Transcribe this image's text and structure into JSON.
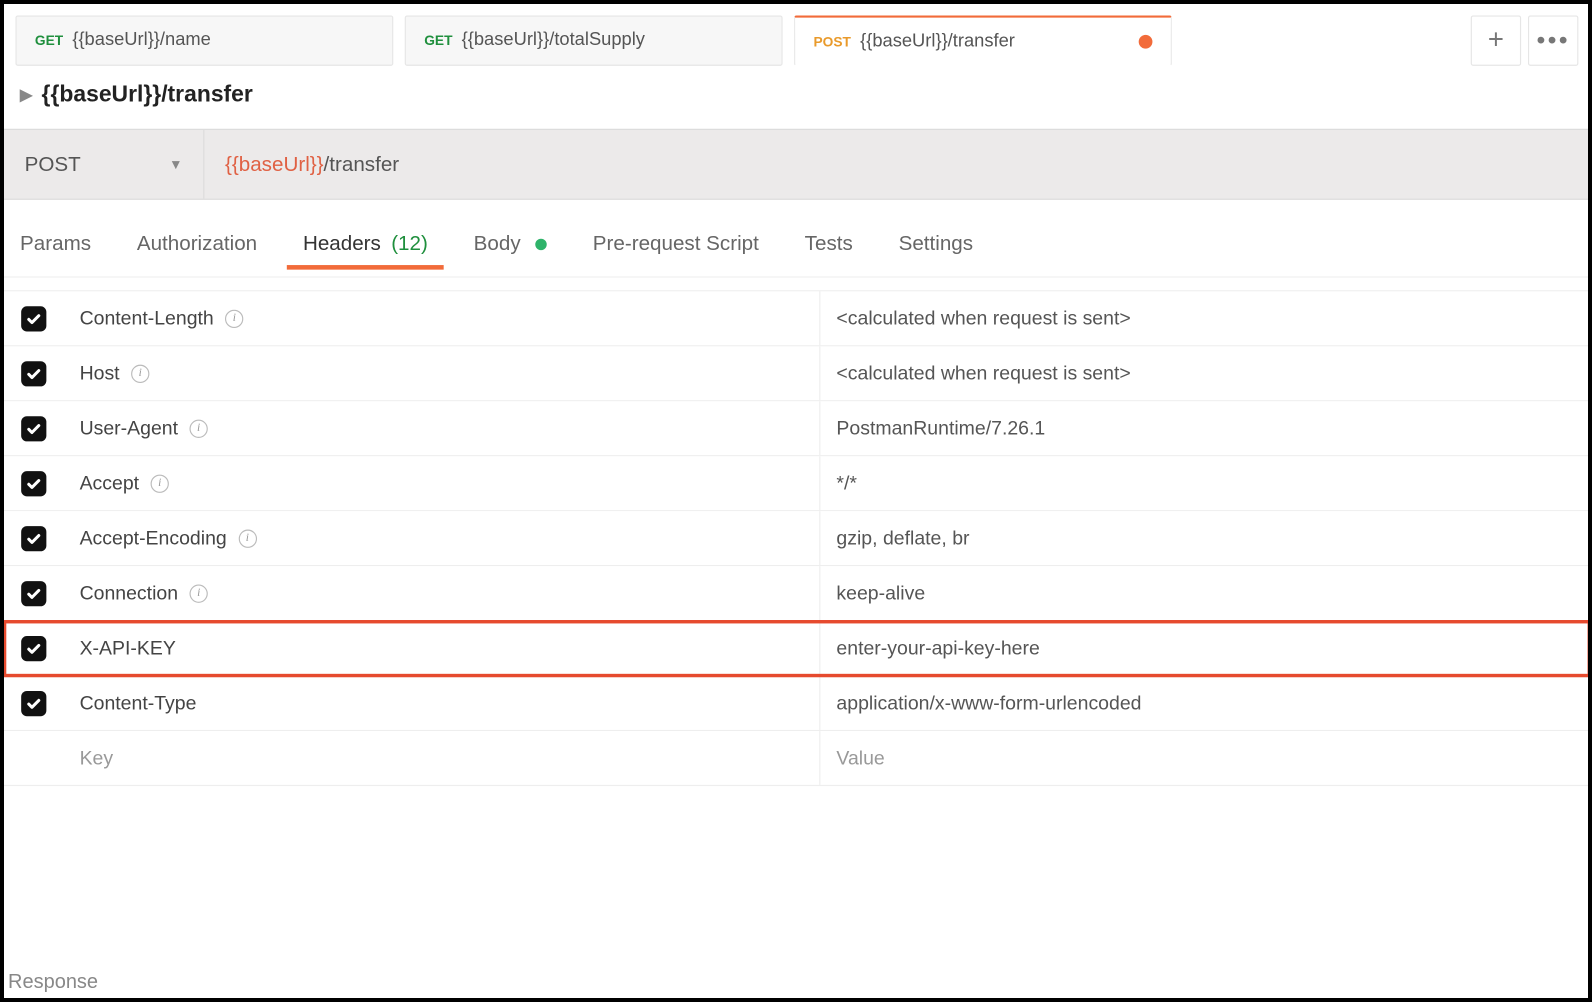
{
  "tabs": [
    {
      "method": "GET",
      "method_class": "get",
      "label": "{{baseUrl}}/name",
      "active": false,
      "unsaved": false
    },
    {
      "method": "GET",
      "method_class": "get",
      "label": "{{baseUrl}}/totalSupply",
      "active": false,
      "unsaved": false
    },
    {
      "method": "POST",
      "method_class": "post",
      "label": "{{baseUrl}}/transfer",
      "active": true,
      "unsaved": true
    }
  ],
  "tab_actions": {
    "plus": "+",
    "dots": "•••"
  },
  "title": {
    "chevron": "▶",
    "text": "{{baseUrl}}/transfer"
  },
  "request": {
    "method": "POST",
    "url_var": "{{baseUrl}}",
    "url_path": "/transfer"
  },
  "subtabs": {
    "params": "Params",
    "authorization": "Authorization",
    "headers": "Headers",
    "headers_count": "(12)",
    "body": "Body",
    "prerequest": "Pre-request Script",
    "tests": "Tests",
    "settings": "Settings"
  },
  "headers": {
    "rows": [
      {
        "checked": true,
        "key": "Content-Length",
        "info": true,
        "value": "<calculated when request is sent>",
        "highlight": false
      },
      {
        "checked": true,
        "key": "Host",
        "info": true,
        "value": "<calculated when request is sent>",
        "highlight": false
      },
      {
        "checked": true,
        "key": "User-Agent",
        "info": true,
        "value": "PostmanRuntime/7.26.1",
        "highlight": false
      },
      {
        "checked": true,
        "key": "Accept",
        "info": true,
        "value": "*/*",
        "highlight": false
      },
      {
        "checked": true,
        "key": "Accept-Encoding",
        "info": true,
        "value": "gzip, deflate, br",
        "highlight": false
      },
      {
        "checked": true,
        "key": "Connection",
        "info": true,
        "value": "keep-alive",
        "highlight": false
      },
      {
        "checked": true,
        "key": "X-API-KEY",
        "info": false,
        "value": "enter-your-api-key-here",
        "highlight": true
      },
      {
        "checked": true,
        "key": "Content-Type",
        "info": false,
        "value": "application/x-www-form-urlencoded",
        "highlight": false
      }
    ],
    "placeholder_key": "Key",
    "placeholder_value": "Value"
  },
  "response_label": "Response"
}
